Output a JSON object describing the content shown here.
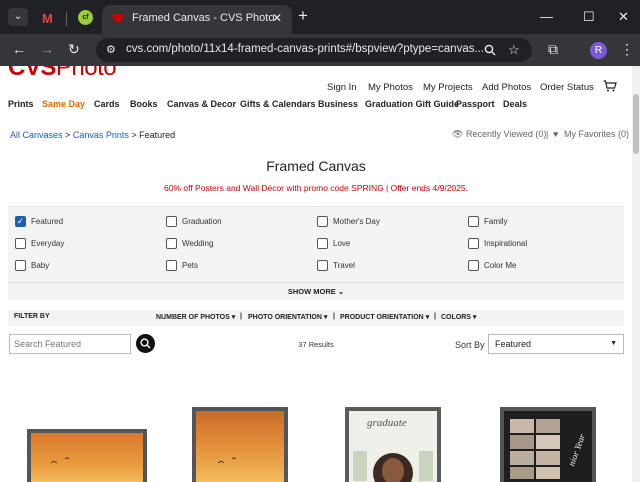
{
  "browser": {
    "tabs": [
      {
        "label": "Gmail",
        "icon": "gmail-icon"
      },
      {
        "label": "",
        "icon": "cf-icon"
      },
      {
        "label": "Framed Canvas - CVS Photo",
        "icon": "heart-icon",
        "active": true
      }
    ],
    "url": "cvs.com/photo/11x14-framed-canvas-prints#/bspview?ptype=canvas...",
    "profile_initial": "R"
  },
  "site": {
    "logo_text": "CVS",
    "logo_photo": "Photo",
    "utility_nav": [
      "Sign In",
      "My Photos",
      "My Projects",
      "Add Photos",
      "Order Status"
    ],
    "main_nav": [
      "Prints",
      "Same Day",
      "Cards",
      "Books",
      "Canvas & Decor",
      "Gifts & Calendars",
      "Business",
      "Graduation Gift Guide",
      "Passport",
      "Deals"
    ],
    "brand_color": "#cc0000",
    "sameday_color": "#e06a00"
  },
  "breadcrumb": {
    "items": [
      "All Canvases",
      "Canvas Prints",
      "Featured"
    ],
    "separator": ">"
  },
  "recent": {
    "recently_viewed": "Recently Viewed (0)",
    "divider": "|",
    "favorites": "My Favorites (0)"
  },
  "page": {
    "title": "Framed Canvas",
    "promo": "60% off Posters and Wall Décor with promo code SPRING | Offer ends 4/9/2025."
  },
  "facets": {
    "items": [
      {
        "label": "Featured",
        "checked": true
      },
      {
        "label": "Graduation",
        "checked": false
      },
      {
        "label": "Mother's Day",
        "checked": false
      },
      {
        "label": "Family",
        "checked": false
      },
      {
        "label": "Everyday",
        "checked": false
      },
      {
        "label": "Wedding",
        "checked": false
      },
      {
        "label": "Love",
        "checked": false
      },
      {
        "label": "Inspirational",
        "checked": false
      },
      {
        "label": "Baby",
        "checked": false
      },
      {
        "label": "Pets",
        "checked": false
      },
      {
        "label": "Travel",
        "checked": false
      },
      {
        "label": "Color Me",
        "checked": false
      }
    ],
    "show_more": "SHOW MORE"
  },
  "filter_bar": {
    "label": "FILTER BY",
    "filters": [
      "NUMBER OF PHOTOS",
      "PHOTO ORIENTATION",
      "PRODUCT ORIENTATION",
      "COLORS"
    ]
  },
  "search": {
    "placeholder": "Search Featured"
  },
  "results": {
    "count_text": "37 Results"
  },
  "sort": {
    "label": "Sort By",
    "value": "Featured"
  },
  "products": [
    {
      "art": "sunset-canvas",
      "graduation_text": "",
      "year_text": ""
    },
    {
      "art": "sunset-canvas",
      "graduation_text": "",
      "year_text": ""
    },
    {
      "art": "graduation-canvas",
      "graduation_text": "graduate",
      "year_text": ""
    },
    {
      "art": "senior-year-collage",
      "graduation_text": "",
      "year_text": "nior Year"
    }
  ]
}
